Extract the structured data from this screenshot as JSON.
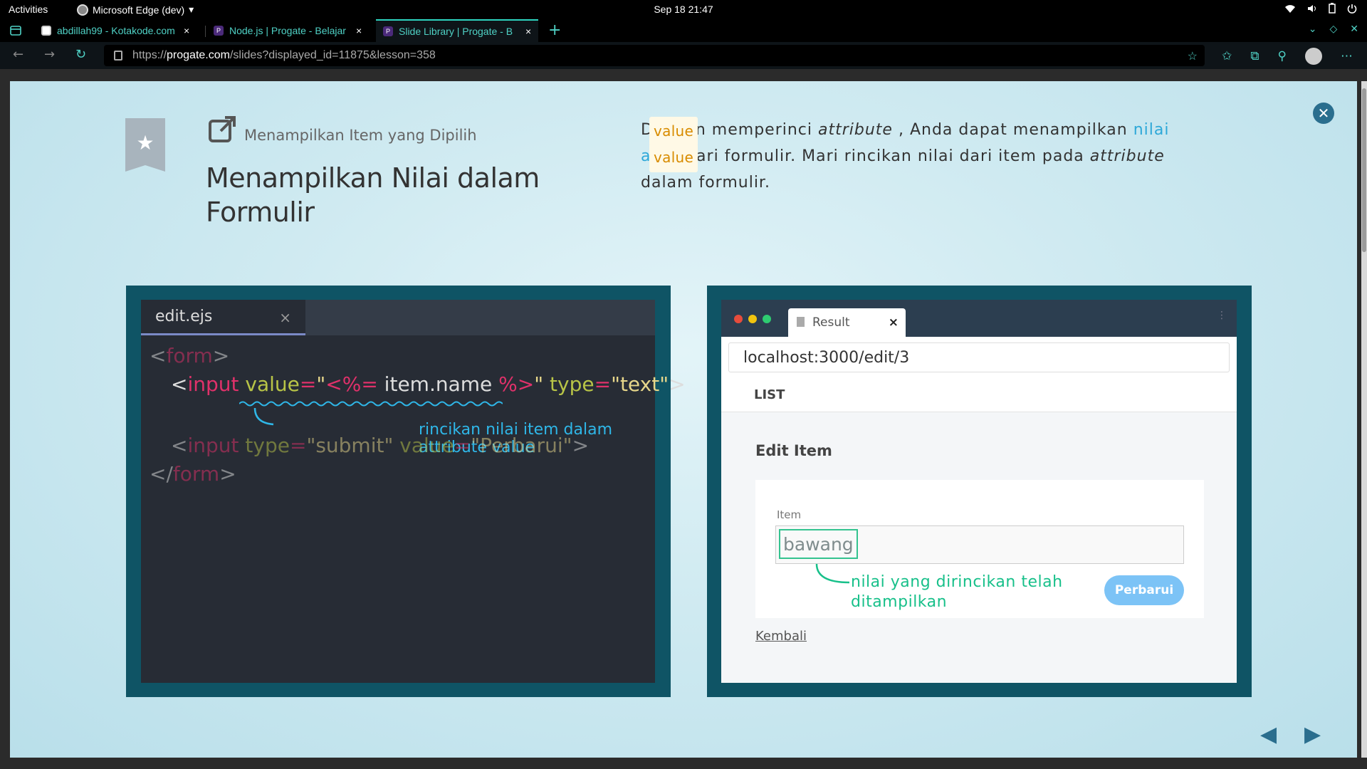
{
  "os": {
    "activities": "Activities",
    "app_name": "Microsoft Edge (dev)",
    "clock": "Sep 18  21:47"
  },
  "browser": {
    "tabs": [
      {
        "title": "abdillah99 - Kotakode.com",
        "active": false
      },
      {
        "title": "Node.js | Progate - Belajar",
        "active": false
      },
      {
        "title": "Slide Library | Progate - B",
        "active": true
      }
    ],
    "url_prefix": "https://",
    "url_domain": "progate.com",
    "url_rest": "/slides?displayed_id=11875&lesson=358"
  },
  "slide": {
    "subtitle": "Menampilkan Item yang Dipilih",
    "title": "Menampilkan Nilai dalam Formulir",
    "desc_1": "Dengan memperinci ",
    "desc_attr_1": "attribute",
    "desc_code_1": "value",
    "desc_2": ", Anda dapat menampilkan ",
    "desc_link": "nilai awal",
    "desc_3": " dari formulir. Mari rincikan nilai dari item pada ",
    "desc_attr_2": "attribute",
    "desc_code_2": "value",
    "desc_4": " dalam formulir."
  },
  "editor": {
    "filename": "edit.ejs",
    "close": "×",
    "line1": {
      "open": "<",
      "tag": "form",
      "close": ">"
    },
    "line2": {
      "open": "<",
      "tag": "input",
      "sp": " ",
      "attr1": "value",
      "eq1": "=",
      "q1": "\"",
      "ejs_open": "<%=",
      "expr": " item.name ",
      "ejs_close": "%>",
      "q2": "\"",
      "sp2": " ",
      "attr2": "type",
      "eq2": "=",
      "str2": "\"text\"",
      "close": ">"
    },
    "annotation": "rincikan nilai item dalam attribute value",
    "line3": {
      "open": "<",
      "tag": "input",
      "sp": " ",
      "attr1": "type",
      "eq1": "=",
      "str1": "\"submit\"",
      "sp2": " ",
      "attr2": "value",
      "eq2": "=",
      "str2": "\"Perbarui\"",
      "close": ">"
    },
    "line4": {
      "open": "</",
      "tag": "form",
      "close": ">"
    }
  },
  "result": {
    "tab_label": "Result",
    "tab_close": "×",
    "address": "localhost:3000/edit/3",
    "nav_label": "LIST",
    "heading": "Edit Item",
    "field_label": "Item",
    "field_value": "bawang",
    "note_line1": "nilai yang dirincikan telah",
    "note_line2": "ditampilkan",
    "button": "Perbarui",
    "back_link": "Kembali"
  },
  "colors": {
    "accent_teal": "#0f5465",
    "link_blue": "#2ea8d8",
    "code_orange": "#d88c00",
    "annotation_green": "#18c08a"
  }
}
